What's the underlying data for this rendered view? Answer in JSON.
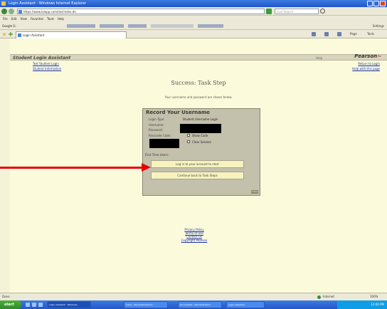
{
  "window": {
    "title": "Login Assistant - Windows Internet Explorer"
  },
  "address_bar": {
    "url": "https://www.lalapp.com/lals/index.do",
    "search_placeholder": "Live Search"
  },
  "menu": [
    "File",
    "Edit",
    "View",
    "Favorites",
    "Tools",
    "Help"
  ],
  "links_bar": {
    "label": "Google G-",
    "right_label": "Settings"
  },
  "tab": {
    "title": "Login Assistant"
  },
  "commands": {
    "page": "Page",
    "tools": "Tools"
  },
  "site": {
    "title": "Student Login Assistant",
    "header_mid": "Help",
    "logo_text": "Pearson",
    "top_left_links": [
      "Test Student Login",
      "Student Information"
    ],
    "top_right_links": [
      "Return to Login",
      "Help with this page"
    ]
  },
  "page": {
    "title": "Success: Task Step",
    "subtitle": "Your username and password are shown below."
  },
  "panel": {
    "title": "Record Your Username",
    "fields": [
      {
        "label": "Login Type:",
        "value": "Student Username Login"
      },
      {
        "label": "Username:",
        "value": ""
      },
      {
        "label": "Password:",
        "value": ""
      },
      {
        "label": "Passcode Code:",
        "value": "Show Code"
      },
      {
        "label": "",
        "value": "Clear Session"
      }
    ],
    "note": "First Time Users:",
    "button_primary": "Log in to your account to start",
    "button_secondary": "Continue back to Task Steps",
    "corner": "Close"
  },
  "footer": {
    "links": [
      "Privacy Policy",
      "Terms of Use",
      "Contact Us",
      "Copyright Pearson"
    ]
  },
  "status": {
    "text": "Done",
    "zone": "Internet",
    "zoom": "100%"
  },
  "taskbar": {
    "start": "start",
    "items": [
      "Login Assistant - Windows...",
      "Inbox - Microsoft Outlook",
      "Document1 - Microsoft Word",
      "Login Assistant"
    ],
    "clock": "12:00 PM"
  }
}
